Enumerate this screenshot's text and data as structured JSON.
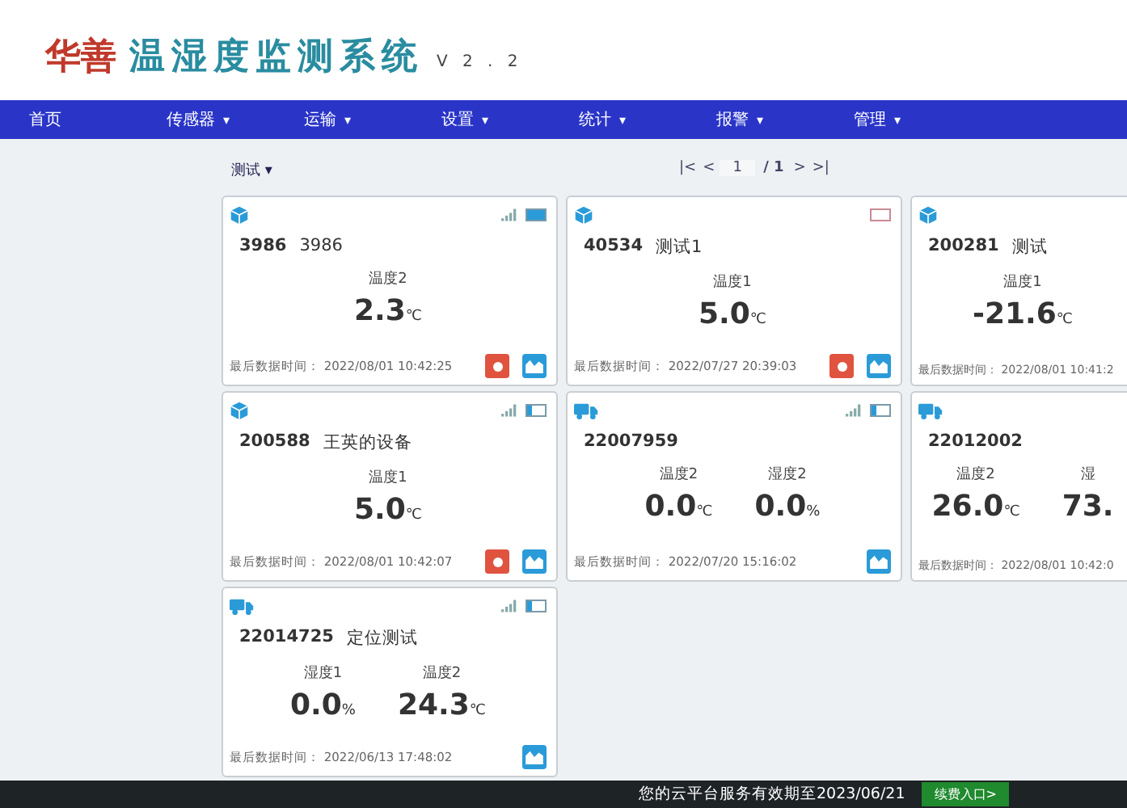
{
  "header": {
    "brand": "华善",
    "title": "温湿度监测系统",
    "version": "V 2 . 2"
  },
  "nav": [
    {
      "label": "首页"
    },
    {
      "label": "传感器",
      "caret": "▾"
    },
    {
      "label": "运输",
      "caret": "▾"
    },
    {
      "label": "设置",
      "caret": "▾"
    },
    {
      "label": "统计",
      "caret": "▾"
    },
    {
      "label": "报警",
      "caret": "▾"
    },
    {
      "label": "管理",
      "caret": "▾"
    }
  ],
  "group_select": {
    "value": "测试",
    "caret": "▾"
  },
  "pager": {
    "first": "|<",
    "prev": "<",
    "page": "1",
    "total": "/ 1",
    "next": ">",
    "last": ">|"
  },
  "cards": [
    {
      "kind": "box",
      "signal": true,
      "battery": {
        "level": 1
      },
      "id": "3986",
      "name": "3986",
      "readings": [
        {
          "label": "温度2",
          "value": "2.3",
          "unit": "℃"
        }
      ],
      "time_label": "最后数据时间：",
      "time": "2022/08/01 10:42:25",
      "alarm": true,
      "chart": true
    },
    {
      "kind": "box",
      "signal": false,
      "battery": {
        "empty": true
      },
      "id": "40534",
      "name": "测试1",
      "readings": [
        {
          "label": "温度1",
          "value": "5.0",
          "unit": "℃"
        }
      ],
      "time_label": "最后数据时间：",
      "time": "2022/07/27 20:39:03",
      "alarm": true,
      "chart": true
    },
    {
      "kind": "box",
      "signal": false,
      "id": "200281",
      "name": "测试",
      "readings": [
        {
          "label": "温度1",
          "value": "-21.6",
          "unit": "℃"
        }
      ],
      "time_label": "最后数据时间：",
      "time": "2022/08/01 10:41:2",
      "alarm": false,
      "chart": false
    },
    {
      "kind": "box",
      "signal": true,
      "battery": {
        "level": 0.3
      },
      "id": "200588",
      "name": "王英的设备",
      "readings": [
        {
          "label": "温度1",
          "value": "5.0",
          "unit": "℃"
        }
      ],
      "time_label": "最后数据时间：",
      "time": "2022/08/01 10:42:07",
      "alarm": true,
      "chart": true
    },
    {
      "kind": "truck",
      "signal": true,
      "battery": {
        "level": 0.3
      },
      "id": "22007959",
      "readings": [
        {
          "label": "温度2",
          "value": "0.0",
          "unit": "℃"
        },
        {
          "label": "湿度2",
          "value": "0.0",
          "unit": "%"
        }
      ],
      "time_label": "最后数据时间：",
      "time": "2022/07/20 15:16:02",
      "alarm": false,
      "chart": true
    },
    {
      "kind": "truck",
      "signal": false,
      "id": "22012002",
      "readings": [
        {
          "label": "温度2",
          "value": "26.0",
          "unit": "℃"
        },
        {
          "label": "湿",
          "value": "73."
        }
      ],
      "time_label": "最后数据时间：",
      "time": "2022/08/01 10:42:0",
      "alarm": false,
      "chart": false
    },
    {
      "kind": "truck",
      "signal": true,
      "battery": {
        "level": 0.3
      },
      "id": "22014725",
      "name": "定位测试",
      "readings": [
        {
          "label": "湿度1",
          "value": "0.0",
          "unit": "%"
        },
        {
          "label": "温度2",
          "value": "24.3",
          "unit": "℃"
        }
      ],
      "time_label": "最后数据时间：",
      "time": "2022/06/13 17:48:02",
      "alarm": false,
      "chart": true
    }
  ],
  "footer": {
    "notice": "您的云平台服务有效期至2023/06/21",
    "renew_button": "续费入口>"
  }
}
